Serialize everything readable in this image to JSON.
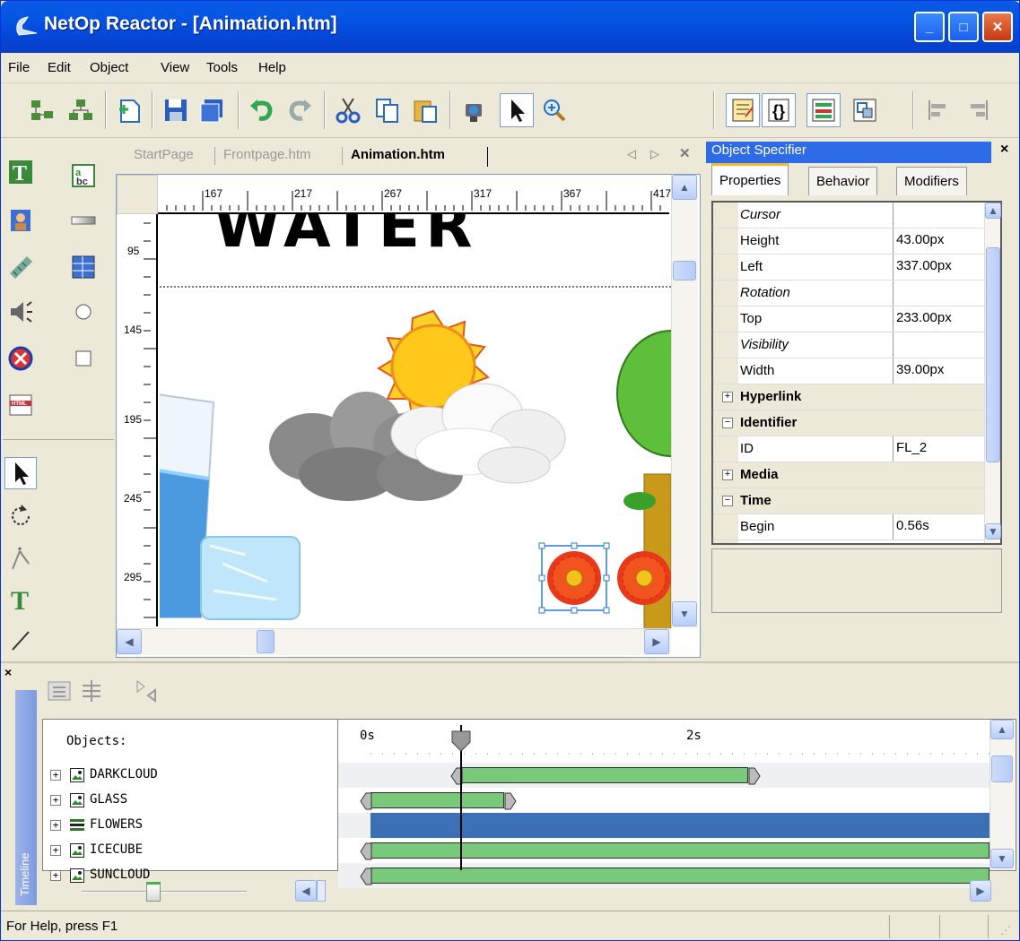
{
  "window": {
    "title": "NetOp Reactor - [Animation.htm]",
    "minimize": "_",
    "maximize": "□",
    "close": "✕"
  },
  "menu": [
    {
      "label": "File"
    },
    {
      "label": "Edit"
    },
    {
      "label": "Object"
    },
    {
      "label": "View"
    },
    {
      "label": "Tools"
    },
    {
      "label": "Help"
    }
  ],
  "toolbar": {
    "icons": [
      "open-project-icon",
      "close-project-icon",
      "new-page-icon",
      "save-icon",
      "save-all-icon",
      "undo-icon",
      "redo-icon",
      "cut-icon",
      "copy-icon",
      "paste-icon",
      "preview-icon",
      "pointer-icon",
      "zoom-icon",
      "properties-panel-icon",
      "script-icon",
      "timeline-panel-icon",
      "layout-icon",
      "align-left-icon",
      "align-right-icon"
    ]
  },
  "doc_tabs": [
    {
      "label": "StartPage"
    },
    {
      "label": "Frontpage.htm"
    },
    {
      "label": "Animation.htm"
    }
  ],
  "ruler": {
    "h_ticks": [
      "167",
      "217",
      "267",
      "317",
      "367",
      "417"
    ],
    "v_ticks": [
      "95",
      "145",
      "195",
      "245",
      "295"
    ]
  },
  "canvas": {
    "heading": "WATER"
  },
  "spec": {
    "title": "Object Specifier",
    "close": "×",
    "tabs": [
      {
        "label": "Properties"
      },
      {
        "label": "Behavior"
      },
      {
        "label": "Modifiers"
      }
    ],
    "rows": [
      {
        "key": "Cursor",
        "value": "",
        "italic": true
      },
      {
        "key": "Height",
        "value": "43.00px"
      },
      {
        "key": "Left",
        "value": "337.00px"
      },
      {
        "key": "Rotation",
        "value": "",
        "italic": true
      },
      {
        "key": "Top",
        "value": "233.00px"
      },
      {
        "key": "Visibility",
        "value": "",
        "italic": true
      },
      {
        "key": "Width",
        "value": "39.00px"
      },
      {
        "key": "Hyperlink",
        "category": true,
        "sign": "+"
      },
      {
        "key": "Identifier",
        "category": true,
        "sign": "−"
      },
      {
        "key": "ID",
        "value": "FL_2"
      },
      {
        "key": "Media",
        "category": true,
        "sign": "+"
      },
      {
        "key": "Time",
        "category": true,
        "sign": "−"
      },
      {
        "key": "Begin",
        "value": "0.56s"
      }
    ]
  },
  "timeline": {
    "side_label": "Timeline",
    "close": "×",
    "objects_header": "Objects:",
    "time_labels": [
      "0s",
      "2s"
    ],
    "objects": [
      {
        "name": "DARKCLOUD",
        "type": "image"
      },
      {
        "name": "GLASS",
        "type": "image"
      },
      {
        "name": "FLOWERS",
        "type": "group"
      },
      {
        "name": "ICECUBE",
        "type": "image"
      },
      {
        "name": "SUNCLOUD",
        "type": "image"
      }
    ],
    "bars": [
      {
        "start": 0.56,
        "end": 2.34
      },
      {
        "start": 0,
        "end": 0.83
      },
      {
        "start": 0,
        "end": 4,
        "selected": true
      },
      {
        "start": 0,
        "end": 4
      },
      {
        "start": 0,
        "end": 4
      }
    ],
    "playhead_s": 0.56
  },
  "status": {
    "text": "For Help, press F1"
  }
}
